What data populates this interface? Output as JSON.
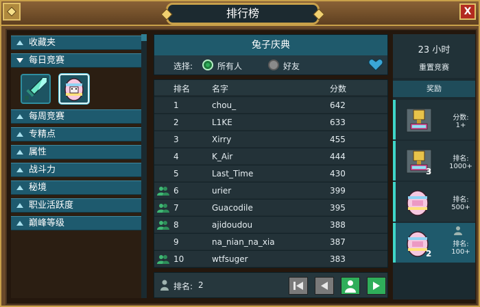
{
  "window": {
    "title": "排行榜",
    "close_label": "X"
  },
  "sidebar": {
    "items": [
      {
        "label": "收藏夹",
        "expanded": false
      },
      {
        "label": "每日竞赛",
        "expanded": true
      },
      {
        "label": "每周竞赛",
        "expanded": false
      },
      {
        "label": "专精点",
        "expanded": false
      },
      {
        "label": "属性",
        "expanded": false
      },
      {
        "label": "战斗力",
        "expanded": false
      },
      {
        "label": "秘境",
        "expanded": false
      },
      {
        "label": "职业活跃度",
        "expanded": false
      },
      {
        "label": "巅峰等级",
        "expanded": false
      }
    ],
    "daily_icons": [
      "sword-icon",
      "egg-icon"
    ],
    "selected_icon": "egg-icon"
  },
  "event": {
    "title": "兔子庆典",
    "filter_label": "选择:",
    "filter_options": [
      {
        "label": "所有人",
        "selected": true
      },
      {
        "label": "好友",
        "selected": false
      }
    ]
  },
  "table": {
    "headers": {
      "rank": "排名",
      "name": "名字",
      "score": "分数"
    },
    "rows": [
      {
        "rank": "1",
        "name": "chou_",
        "score": "642",
        "friend": false
      },
      {
        "rank": "2",
        "name": "L1KE",
        "score": "633",
        "friend": false
      },
      {
        "rank": "3",
        "name": "Xirry",
        "score": "455",
        "friend": false
      },
      {
        "rank": "4",
        "name": "K_Air",
        "score": "444",
        "friend": false
      },
      {
        "rank": "5",
        "name": "Last_Time",
        "score": "430",
        "friend": false
      },
      {
        "rank": "6",
        "name": "urier",
        "score": "399",
        "friend": true
      },
      {
        "rank": "7",
        "name": "Guacodile",
        "score": "395",
        "friend": true
      },
      {
        "rank": "8",
        "name": "ajidoudou",
        "score": "388",
        "friend": true
      },
      {
        "rank": "9",
        "name": "na_nian_na_xia",
        "score": "387",
        "friend": false
      },
      {
        "rank": "10",
        "name": "wtfsuger",
        "score": "383",
        "friend": true
      }
    ]
  },
  "my_rank": {
    "label": "排名:",
    "value": "2"
  },
  "nav_buttons": [
    "first-page-icon",
    "prev-page-icon",
    "my-position-icon",
    "next-page-icon"
  ],
  "right_panel": {
    "timer": "23 小时",
    "reset_label": "重置竞赛",
    "rewards_header": "奖励",
    "rewards": [
      {
        "label": "分数:\n1+",
        "icon": "trophy-icon",
        "count": "",
        "highlight": true,
        "active": false,
        "person": false
      },
      {
        "label": "排名:\n1000+",
        "icon": "trophy-icon",
        "count": "3",
        "highlight": true,
        "active": false,
        "person": false
      },
      {
        "label": "排名:\n500+",
        "icon": "egg-icon",
        "count": "",
        "highlight": true,
        "active": false,
        "person": false
      },
      {
        "label": "排名:\n100+",
        "icon": "egg-icon",
        "count": "2",
        "highlight": true,
        "active": true,
        "person": true
      }
    ]
  },
  "colors": {
    "accent": "#1f5a6c",
    "frame_gold": "#c9a14a",
    "highlight": "#3fd6c8",
    "close_red": "#b32b20"
  }
}
